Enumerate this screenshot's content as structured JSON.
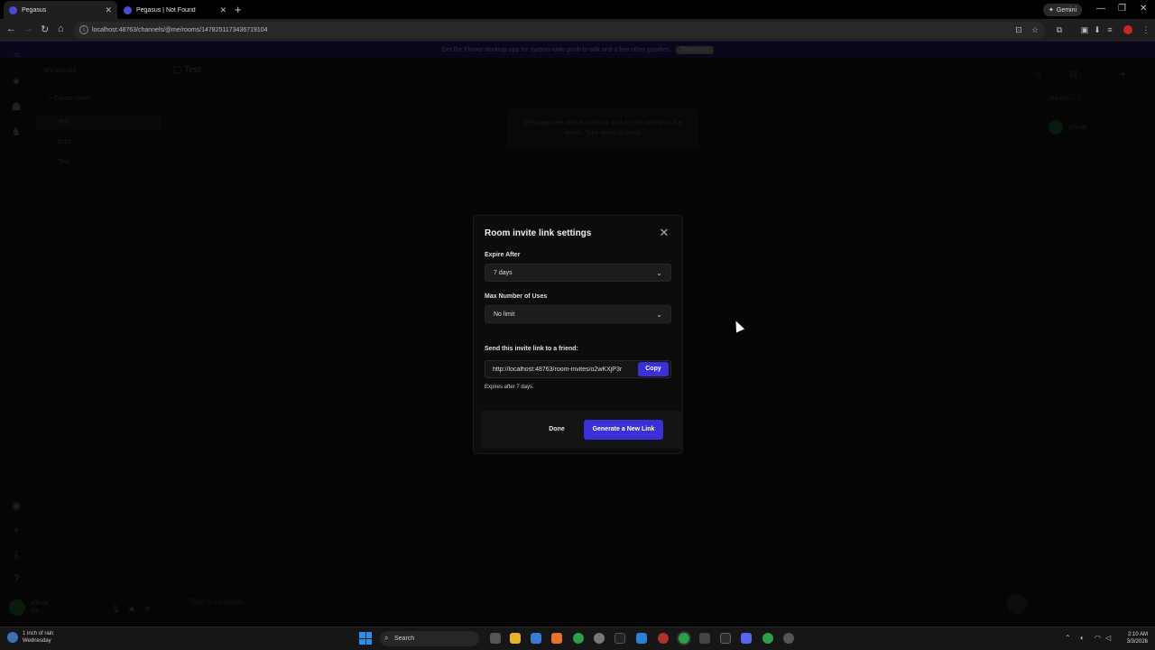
{
  "browser": {
    "tabs": [
      {
        "title": "Pegasus",
        "active": true
      },
      {
        "title": "Pegasus | Not Found",
        "active": false
      }
    ],
    "gemini_label": "Gemini",
    "url": "localhost:48763/channels/@me/rooms/1478251173436719104"
  },
  "app": {
    "banner_text": "Get the Flower desktop app for system-wide push-to-talk and a few other goodies.",
    "banner_button": "Download",
    "section_title": "SFC ROOMS",
    "create_room": "Create room",
    "rooms": [
      "Test",
      "bcbb",
      "Test"
    ],
    "channel_title": "Test",
    "notice": "Messages are sent in real time and are not stored on the server. Type below to send.",
    "online_label": "ONLINE — 1",
    "member_name": "official",
    "user_name": "official",
    "user_status": "On...",
    "message_placeholder": "Type a message..."
  },
  "modal": {
    "title": "Room invite link settings",
    "expire_label": "Expire After",
    "expire_value": "7 days",
    "uses_label": "Max Number of Uses",
    "uses_value": "No limit",
    "send_label": "Send this invite link to a friend:",
    "link_value": "http://localhost:48763/room-invites/o2wKXjP3r",
    "copy_button": "Copy",
    "expires_note": "Expires after 7 days.",
    "done_button": "Done",
    "generate_button": "Generate a New Link"
  },
  "taskbar": {
    "weather_line1": "1 inch of rain",
    "weather_line2": "Wednesday",
    "search_placeholder": "Search",
    "time": "2:10 AM",
    "date": "3/3/2026"
  },
  "colors": {
    "accent": "#3b2fd6",
    "modal_bg": "#0c0c0c",
    "page_bg": "#080808"
  }
}
